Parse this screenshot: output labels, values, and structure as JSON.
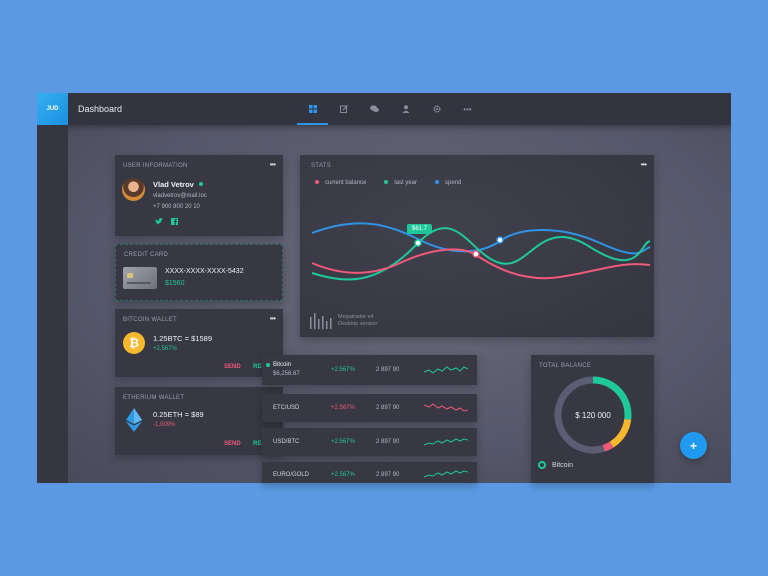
{
  "app": {
    "logo_text": "JUD",
    "title": "Dashboard"
  },
  "nav": [
    {
      "icon": "grid-icon"
    },
    {
      "icon": "edit-icon"
    },
    {
      "icon": "chat-icon"
    },
    {
      "icon": "user-icon"
    },
    {
      "icon": "gear-icon"
    },
    {
      "icon": "more-icon"
    }
  ],
  "more_label": "•••",
  "user": {
    "section_title": "USER INFORMATION",
    "name": "Vlad Vetrov",
    "email": "vladvetrov@mail.loc",
    "phone": "+7 900 800 20 10",
    "status_color": "#1fc89a"
  },
  "credit_card": {
    "section_title": "CREDIT CARD",
    "number": "XXXX-XXXX-XXXX-5432",
    "amount": "$1560"
  },
  "bitcoin_wallet": {
    "section_title": "BITCOIN WALLET",
    "value": "1.25BTC = $1589",
    "change": "+2.567%",
    "send": "SEND",
    "receive": "RESIVE"
  },
  "ethereum_wallet": {
    "section_title": "ETHERIUM WALLET",
    "value": "0.25ETH = $89",
    "change": "-1.009%",
    "send": "SEND",
    "receive": "RESIVE"
  },
  "stats": {
    "section_title": "STATS",
    "legend": [
      {
        "label": "current balance",
        "color": "#ee5a78"
      },
      {
        "label": "last year",
        "color": "#1fc89a"
      },
      {
        "label": "spend",
        "color": "#2f93e6"
      }
    ],
    "tooltip": "$61.7",
    "footer_line1": "Megatrader v4",
    "footer_line2": "Desktop version"
  },
  "markets": [
    {
      "name": "Bitcoin",
      "sub": "$6,256.67",
      "change": "+2.567%",
      "price": "2 897 90",
      "trend": "up",
      "active": true
    },
    {
      "name": "ETC/USD",
      "sub": "",
      "change": "+2.567%",
      "price": "2 897 90",
      "trend": "down",
      "active": false
    },
    {
      "name": "USD/BTC",
      "sub": "",
      "change": "+2.567%",
      "price": "2 897 90",
      "trend": "up",
      "active": false
    },
    {
      "name": "EURO/GOLD",
      "sub": "",
      "change": "+2.567%",
      "price": "2 897 90",
      "trend": "up",
      "active": false
    }
  ],
  "total_balance": {
    "section_title": "TOTAL BALANCE",
    "amount": "$ 120 000",
    "legend_label": "Bitcoin",
    "segments": [
      {
        "name": "green",
        "fraction": 0.27,
        "color": "#1fc89a"
      },
      {
        "name": "yellow",
        "fraction": 0.14,
        "color": "#f5b82e"
      },
      {
        "name": "red",
        "fraction": 0.04,
        "color": "#ee5a78"
      },
      {
        "name": "rest",
        "fraction": 0.55,
        "color": "#5b5d72"
      }
    ]
  },
  "fab_label": "+"
}
